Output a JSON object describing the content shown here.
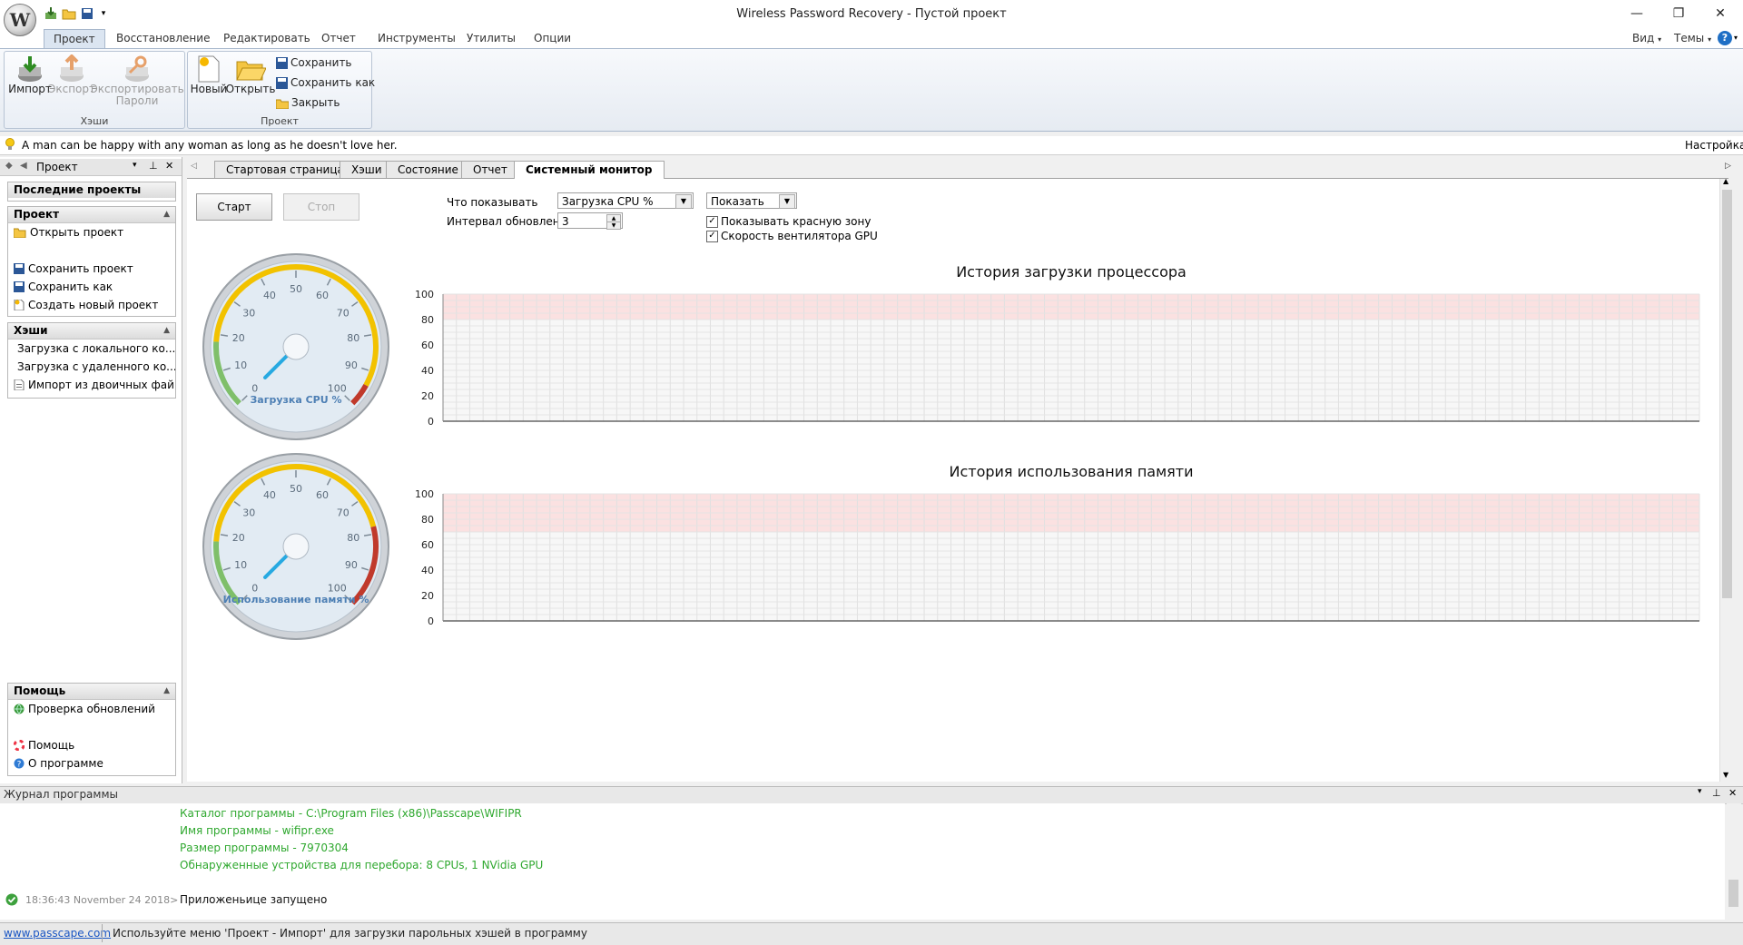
{
  "window": {
    "title": "Wireless Password Recovery - Пустой проект",
    "logo_letter": "W",
    "minimize": "—",
    "maximize": "❐",
    "close": "✕"
  },
  "menu": {
    "tabs": [
      "Проект",
      "Восстановление",
      "Редактировать",
      "Отчет",
      "Инструменты",
      "Утилиты",
      "Опции"
    ],
    "right": {
      "view": "Вид",
      "themes": "Темы",
      "help": "?"
    }
  },
  "ribbon": {
    "groups": {
      "hashes": {
        "label": "Хэши",
        "import": "Импорт",
        "export": "Экспорт",
        "export_passwords_1": "Экспортировать",
        "export_passwords_2": "Пароли"
      },
      "project": {
        "label": "Проект",
        "new": "Новый",
        "open": "Открыть",
        "save": "Сохранить",
        "save_as": "Сохранить как",
        "close": "Закрыть"
      }
    }
  },
  "tipbar": {
    "text": "A man can be happy with any woman as long as he doesn't love her.",
    "settings": "Настройка"
  },
  "left_pane": {
    "title": "Проект",
    "recent": {
      "header": "Последние проекты"
    },
    "project": {
      "header": "Проект",
      "items": [
        "Открыть проект",
        "Сохранить проект",
        "Сохранить как",
        "Создать новый проект"
      ]
    },
    "hashes": {
      "header": "Хэши",
      "items": [
        "Загрузка с локального ко...",
        "Загрузка с удаленного ко...",
        "Импорт из двоичных фай"
      ]
    },
    "help": {
      "header": "Помощь",
      "items": [
        "Проверка обновлений",
        "Помощь",
        "О программе"
      ]
    }
  },
  "doc_tabs": [
    "Стартовая страница",
    "Хэши",
    "Состояние",
    "Отчет",
    "Системный монитор"
  ],
  "monitor": {
    "start": "Старт",
    "stop": "Стоп",
    "what_label": "Что показывать",
    "what_value": "Загрузка CPU %",
    "show_value": "Показать",
    "interval_label": "Интервал обновления",
    "interval_value": "3",
    "show_red_zone": "Показывать красную зону",
    "gpu_fan": "Скорость вентилятора GPU",
    "cpu_gauge": {
      "label": "Загрузка CPU %",
      "value": 0
    },
    "mem_gauge": {
      "label": "Использование памяти %",
      "value": 0
    },
    "gauge_ticks": [
      "0",
      "10",
      "20",
      "30",
      "40",
      "50",
      "60",
      "70",
      "80",
      "90",
      "100"
    ]
  },
  "chart_data": [
    {
      "type": "line",
      "title": "История загрузки процессора",
      "ylim": [
        0,
        100
      ],
      "yticks": [
        "100",
        "80",
        "60",
        "40",
        "20",
        "0"
      ],
      "red_zone": [
        80,
        100
      ],
      "grid": true,
      "series": []
    },
    {
      "type": "line",
      "title": "История использования памяти",
      "ylim": [
        0,
        100
      ],
      "yticks": [
        "100",
        "80",
        "60",
        "40",
        "20",
        "0"
      ],
      "red_zone": [
        70,
        100
      ],
      "grid": true,
      "series": []
    }
  ],
  "log": {
    "title": "Журнал программы",
    "lines": [
      "Каталог программы - C:\\Program Files (x86)\\Passcape\\WIFIPR",
      "Имя программы - wifipr.exe",
      "Размер программы - 7970304",
      "Обнаруженные устройства для перебора:  8 CPUs, 1 NVidia GPU"
    ],
    "timestamp": "18:36:43 November 24 2018>",
    "message": "Приложеньице запущено"
  },
  "status": {
    "link": "www.passcape.com",
    "text": "Используйте меню 'Проект - Импорт' для загрузки парольных хэшей в программу"
  },
  "colors": {
    "accent": "#dbe5f1",
    "log_green": "#2fa82f",
    "red_zone": "#fbe1e1",
    "gauge_yellow": "#f2c200",
    "gauge_red": "#c0392b",
    "needle": "#27a9e1"
  }
}
